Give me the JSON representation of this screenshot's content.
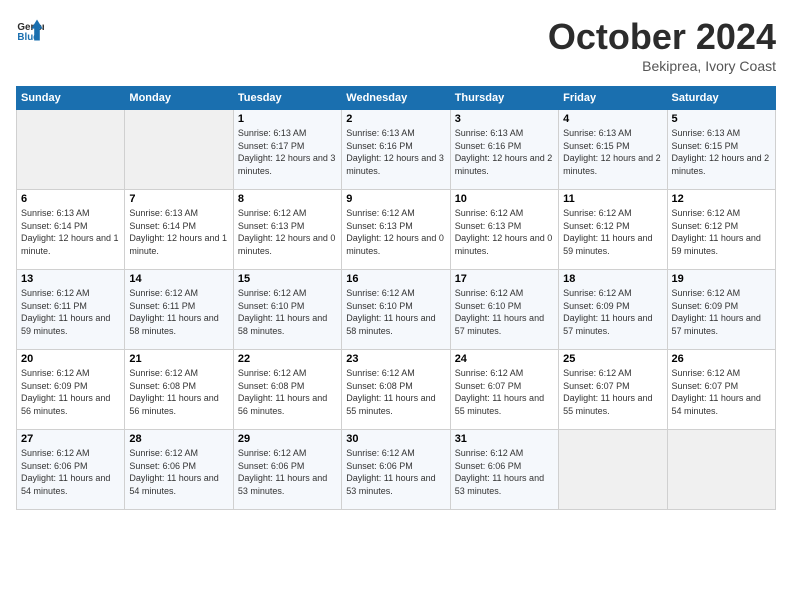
{
  "header": {
    "logo_general": "General",
    "logo_blue": "Blue",
    "month_title": "October 2024",
    "location": "Bekiprea, Ivory Coast"
  },
  "weekdays": [
    "Sunday",
    "Monday",
    "Tuesday",
    "Wednesday",
    "Thursday",
    "Friday",
    "Saturday"
  ],
  "weeks": [
    [
      {
        "day": "",
        "empty": true
      },
      {
        "day": "",
        "empty": true
      },
      {
        "day": "1",
        "sunrise": "6:13 AM",
        "sunset": "6:17 PM",
        "daylight": "12 hours and 3 minutes."
      },
      {
        "day": "2",
        "sunrise": "6:13 AM",
        "sunset": "6:16 PM",
        "daylight": "12 hours and 3 minutes."
      },
      {
        "day": "3",
        "sunrise": "6:13 AM",
        "sunset": "6:16 PM",
        "daylight": "12 hours and 2 minutes."
      },
      {
        "day": "4",
        "sunrise": "6:13 AM",
        "sunset": "6:15 PM",
        "daylight": "12 hours and 2 minutes."
      },
      {
        "day": "5",
        "sunrise": "6:13 AM",
        "sunset": "6:15 PM",
        "daylight": "12 hours and 2 minutes."
      }
    ],
    [
      {
        "day": "6",
        "sunrise": "6:13 AM",
        "sunset": "6:14 PM",
        "daylight": "12 hours and 1 minute."
      },
      {
        "day": "7",
        "sunrise": "6:13 AM",
        "sunset": "6:14 PM",
        "daylight": "12 hours and 1 minute."
      },
      {
        "day": "8",
        "sunrise": "6:12 AM",
        "sunset": "6:13 PM",
        "daylight": "12 hours and 0 minutes."
      },
      {
        "day": "9",
        "sunrise": "6:12 AM",
        "sunset": "6:13 PM",
        "daylight": "12 hours and 0 minutes."
      },
      {
        "day": "10",
        "sunrise": "6:12 AM",
        "sunset": "6:13 PM",
        "daylight": "12 hours and 0 minutes."
      },
      {
        "day": "11",
        "sunrise": "6:12 AM",
        "sunset": "6:12 PM",
        "daylight": "11 hours and 59 minutes."
      },
      {
        "day": "12",
        "sunrise": "6:12 AM",
        "sunset": "6:12 PM",
        "daylight": "11 hours and 59 minutes."
      }
    ],
    [
      {
        "day": "13",
        "sunrise": "6:12 AM",
        "sunset": "6:11 PM",
        "daylight": "11 hours and 59 minutes."
      },
      {
        "day": "14",
        "sunrise": "6:12 AM",
        "sunset": "6:11 PM",
        "daylight": "11 hours and 58 minutes."
      },
      {
        "day": "15",
        "sunrise": "6:12 AM",
        "sunset": "6:10 PM",
        "daylight": "11 hours and 58 minutes."
      },
      {
        "day": "16",
        "sunrise": "6:12 AM",
        "sunset": "6:10 PM",
        "daylight": "11 hours and 58 minutes."
      },
      {
        "day": "17",
        "sunrise": "6:12 AM",
        "sunset": "6:10 PM",
        "daylight": "11 hours and 57 minutes."
      },
      {
        "day": "18",
        "sunrise": "6:12 AM",
        "sunset": "6:09 PM",
        "daylight": "11 hours and 57 minutes."
      },
      {
        "day": "19",
        "sunrise": "6:12 AM",
        "sunset": "6:09 PM",
        "daylight": "11 hours and 57 minutes."
      }
    ],
    [
      {
        "day": "20",
        "sunrise": "6:12 AM",
        "sunset": "6:09 PM",
        "daylight": "11 hours and 56 minutes."
      },
      {
        "day": "21",
        "sunrise": "6:12 AM",
        "sunset": "6:08 PM",
        "daylight": "11 hours and 56 minutes."
      },
      {
        "day": "22",
        "sunrise": "6:12 AM",
        "sunset": "6:08 PM",
        "daylight": "11 hours and 56 minutes."
      },
      {
        "day": "23",
        "sunrise": "6:12 AM",
        "sunset": "6:08 PM",
        "daylight": "11 hours and 55 minutes."
      },
      {
        "day": "24",
        "sunrise": "6:12 AM",
        "sunset": "6:07 PM",
        "daylight": "11 hours and 55 minutes."
      },
      {
        "day": "25",
        "sunrise": "6:12 AM",
        "sunset": "6:07 PM",
        "daylight": "11 hours and 55 minutes."
      },
      {
        "day": "26",
        "sunrise": "6:12 AM",
        "sunset": "6:07 PM",
        "daylight": "11 hours and 54 minutes."
      }
    ],
    [
      {
        "day": "27",
        "sunrise": "6:12 AM",
        "sunset": "6:06 PM",
        "daylight": "11 hours and 54 minutes."
      },
      {
        "day": "28",
        "sunrise": "6:12 AM",
        "sunset": "6:06 PM",
        "daylight": "11 hours and 54 minutes."
      },
      {
        "day": "29",
        "sunrise": "6:12 AM",
        "sunset": "6:06 PM",
        "daylight": "11 hours and 53 minutes."
      },
      {
        "day": "30",
        "sunrise": "6:12 AM",
        "sunset": "6:06 PM",
        "daylight": "11 hours and 53 minutes."
      },
      {
        "day": "31",
        "sunrise": "6:12 AM",
        "sunset": "6:06 PM",
        "daylight": "11 hours and 53 minutes."
      },
      {
        "day": "",
        "empty": true
      },
      {
        "day": "",
        "empty": true
      }
    ]
  ],
  "labels": {
    "sunrise": "Sunrise:",
    "sunset": "Sunset:",
    "daylight": "Daylight:"
  }
}
